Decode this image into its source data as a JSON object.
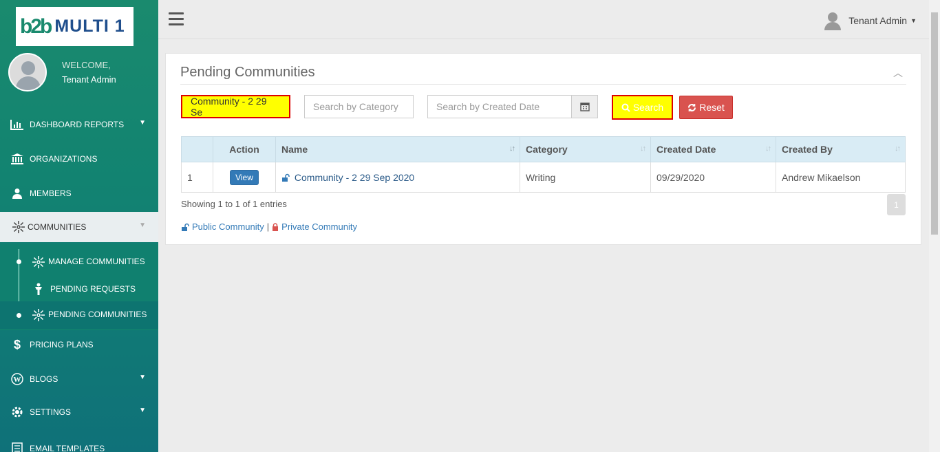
{
  "brand": {
    "mark": "b2b",
    "name": "MULTI 1"
  },
  "user": {
    "welcome": "WELCOME,",
    "name": "Tenant Admin"
  },
  "nav": {
    "dashboard": "DASHBOARD REPORTS",
    "organizations": "ORGANIZATIONS",
    "members": "MEMBERS",
    "communities": "COMMUNITIES",
    "manage_communities": "MANAGE COMMUNITIES",
    "pending_requests": "PENDING REQUESTS",
    "pending_communities": "PENDING COMMUNITIES",
    "pricing_plans": "PRICING PLANS",
    "blogs": "BLOGS",
    "settings": "SETTINGS",
    "email_templates": "EMAIL TEMPLATES"
  },
  "topbar": {
    "user_label": "Tenant Admin"
  },
  "panel": {
    "title": "Pending Communities"
  },
  "filters": {
    "name_value": "Community - 2 29 Se",
    "category_placeholder": "Search by Category",
    "date_placeholder": "Search by Created Date",
    "search_label": "Search",
    "reset_label": "Reset"
  },
  "table": {
    "headers": {
      "num": "",
      "action": "Action",
      "name": "Name",
      "category": "Category",
      "created_date": "Created Date",
      "created_by": "Created By"
    },
    "rows": [
      {
        "num": "1",
        "action": "View",
        "name": "Community - 2 29 Sep 2020",
        "category": "Writing",
        "created_date": "09/29/2020",
        "created_by": "Andrew Mikaelson"
      }
    ]
  },
  "footer": {
    "showing": "Showing 1 to 1 of 1 entries",
    "page": "1",
    "legend_public": "Public Community",
    "legend_sep": "|",
    "legend_private": "Private Community"
  },
  "colors": {
    "sidebar": "#128371",
    "highlight_yellow": "#ffff00",
    "highlight_border": "#dd0000",
    "reset_red": "#d9534f",
    "view_blue": "#337ab7"
  }
}
